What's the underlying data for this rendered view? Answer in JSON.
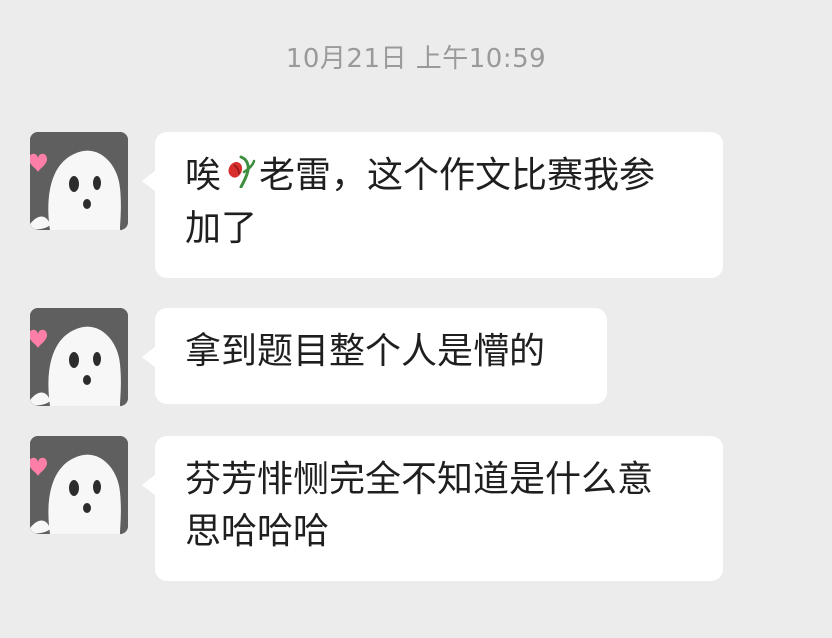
{
  "chat": {
    "timestamp": "10月21日 上午10:59",
    "messages": [
      {
        "line1_prefix": "唉",
        "line1_suffix": "老雷，这个作文比赛我参",
        "line2": "加了",
        "inline_icon": "wilted-rose-icon"
      },
      {
        "line1": "拿到题目整个人是懵的"
      },
      {
        "line1": "芬芳悱恻完全不知道是什么意",
        "line2": "思哈哈哈"
      }
    ]
  }
}
